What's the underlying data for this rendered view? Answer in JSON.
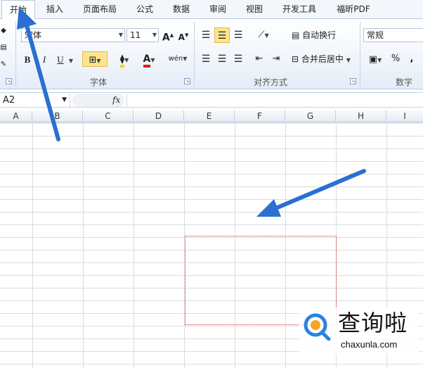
{
  "ribbon_tabs": [
    "开始",
    "插入",
    "页面布局",
    "公式",
    "数据",
    "审阅",
    "视图",
    "开发工具",
    "福昕PDF"
  ],
  "font_group": {
    "font_name": "宋体",
    "font_size": "11",
    "grow": "A",
    "shrink": "A",
    "bold": "B",
    "italic": "I",
    "underline": "U",
    "font_color_letter": "A",
    "phonetic": "wén",
    "label": "字体"
  },
  "alignment_group": {
    "wrap_text": "自动换行",
    "merge_center": "合并后居中",
    "label": "对齐方式"
  },
  "number_group": {
    "format": "常规",
    "percent": "%",
    "comma": ",",
    "label": "数字"
  },
  "formula_bar": {
    "name_box": "A2",
    "fx": "fx",
    "formula": ""
  },
  "columns": [
    "A",
    "B",
    "C",
    "D",
    "E",
    "F",
    "G",
    "H",
    "I"
  ],
  "watermark": {
    "name": "查询啦",
    "url": "chaxunla.com"
  },
  "colors": {
    "annotation_arrow": "#2a6fd1",
    "selection_border": "#d32a2a",
    "active_tab_border": "#b8c9df",
    "font_color": "#d81e1e",
    "highlight": "#f5d400"
  }
}
